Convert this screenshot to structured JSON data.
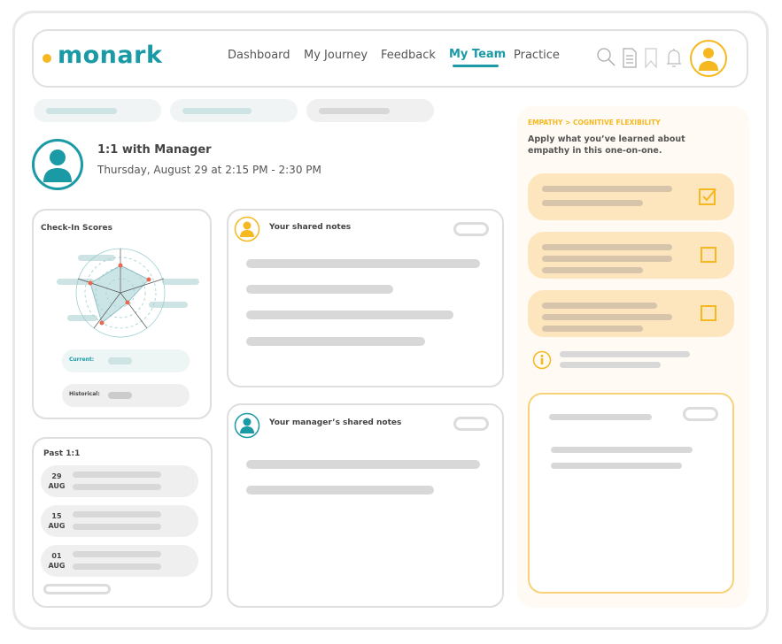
{
  "brand": {
    "name": "monark"
  },
  "nav": {
    "items": [
      "Dashboard",
      "My Journey",
      "Feedback",
      "My Team",
      "Practice"
    ],
    "active": "My Team"
  },
  "icons": [
    "search-icon",
    "document-icon",
    "bookmark-icon",
    "bell-icon",
    "avatar-icon"
  ],
  "meeting": {
    "title": "1:1 with Manager",
    "datetime": "Thursday, August 29 at 2:15 PM - 2:30 PM"
  },
  "checkin": {
    "title": "Check-In Scores",
    "current_label": "Current:",
    "historical_label": "Historical:"
  },
  "past": {
    "title": "Past 1:1",
    "rows": [
      {
        "day": "29",
        "month": "AUG"
      },
      {
        "day": "15",
        "month": "AUG"
      },
      {
        "day": "01",
        "month": "AUG"
      }
    ]
  },
  "notes": {
    "shared": "Your shared notes",
    "manager": "Your manager’s shared notes"
  },
  "panel": {
    "breadcrumb": "EMPATHY > COGNITIVE FLEXIBILITY",
    "prompt": "Apply what you’ve learned about empathy in this one-on-one.",
    "tasks_checked": [
      true,
      false,
      false
    ]
  },
  "colors": {
    "brand": "#1a9aa5",
    "accent": "#f5b820"
  }
}
